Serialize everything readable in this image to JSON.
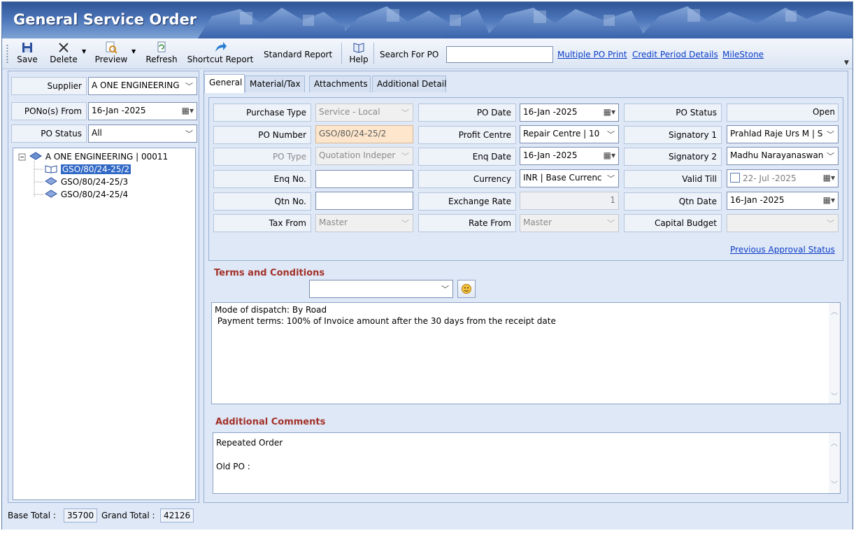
{
  "window": {
    "title": "General Service Order"
  },
  "toolbar": {
    "save": "Save",
    "delete": "Delete",
    "preview": "Preview",
    "refresh": "Refresh",
    "shortcut_report": "Shortcut Report",
    "standard_report": "Standard Report",
    "help": "Help",
    "search_label": "Search For PO",
    "search_value": "",
    "links": [
      "Multiple PO Print",
      "Credit Period Details",
      "MileStone"
    ]
  },
  "filters": {
    "supplier_label": "Supplier",
    "supplier_value": "A ONE ENGINEERING",
    "pono_from_label": "PONo(s)  From",
    "pono_from_value": "16-Jan -2025",
    "po_status_label": "PO Status",
    "po_status_value": "All"
  },
  "tree": {
    "root": "A ONE ENGINEERING | 00011",
    "items": [
      "GSO/80/24-25/2",
      "GSO/80/24-25/3",
      "GSO/80/24-25/4"
    ],
    "selected_index": 0
  },
  "footer": {
    "base_total_label": "Base Total :",
    "base_total_value": "35700",
    "grand_total_label": "Grand Total :",
    "grand_total_value": "42126"
  },
  "tabs": [
    "General",
    "Material/Tax",
    "Attachments",
    "Additional Detail"
  ],
  "active_tab": "General",
  "general": {
    "purchase_type_label": "Purchase Type",
    "purchase_type_value": "Service - Local",
    "po_number_label": "PO Number",
    "po_number_value": "GSO/80/24-25/2",
    "po_type_label": "PO Type",
    "po_type_value": "Quotation Indeper",
    "enq_no_label": "Enq No.",
    "enq_no_value": "",
    "qtn_no_label": "Qtn No.",
    "qtn_no_value": "",
    "tax_from_label": "Tax From",
    "tax_from_value": "Master",
    "po_date_label": "PO Date",
    "po_date_value": "16-Jan -2025",
    "profit_centre_label": "Profit Centre",
    "profit_centre_value": "Repair Centre | 10",
    "enq_date_label": "Enq Date",
    "enq_date_value": "16-Jan -2025",
    "currency_label": "Currency",
    "currency_value": "INR | Base Currenc",
    "exchange_rate_label": "Exchange Rate",
    "exchange_rate_value": "1",
    "rate_from_label": "Rate From",
    "rate_from_value": "Master",
    "po_status_label": "PO Status",
    "po_status_value": "Open",
    "signatory1_label": "Signatory 1",
    "signatory1_value": "Prahlad Raje Urs M | S",
    "signatory2_label": "Signatory 2",
    "signatory2_value": "Madhu Narayanaswan",
    "valid_till_label": "Valid Till",
    "valid_till_value": "22- Jul -2025",
    "qtn_date_label": "Qtn Date",
    "qtn_date_value": "16-Jan -2025",
    "capital_budget_label": "Capital Budget",
    "capital_budget_value": "",
    "prev_approval_link": "Previous Approval Status"
  },
  "terms": {
    "title": "Terms and Conditions",
    "template_value": "",
    "lines": [
      "Mode of dispatch: By Road",
      " Payment terms: 100% of Invoice amount after the 30 days from the receipt date"
    ]
  },
  "comments": {
    "title": "Additional Comments",
    "lines": [
      "Repeated Order",
      "",
      "Old PO :"
    ]
  }
}
